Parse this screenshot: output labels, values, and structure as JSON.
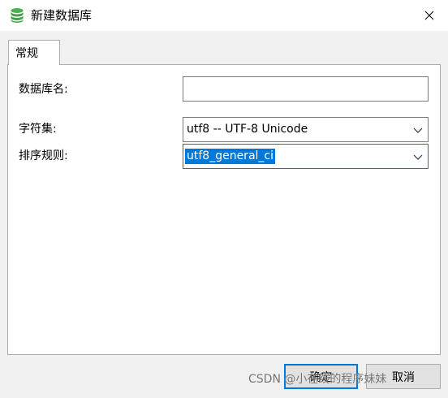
{
  "window": {
    "title": "新建数据库",
    "icon": "database-icon",
    "close_icon": "close-icon"
  },
  "tabs": [
    {
      "label": "常规",
      "active": true
    }
  ],
  "form": {
    "db_name": {
      "label": "数据库名:",
      "value": ""
    },
    "charset": {
      "label": "字符集:",
      "value": "utf8 -- UTF-8 Unicode"
    },
    "collation": {
      "label": "排序规则:",
      "value": "utf8_general_ci"
    }
  },
  "buttons": {
    "ok": "确定",
    "cancel": "取消"
  },
  "watermark": "CSDN @小在线的程序妹妹",
  "colors": {
    "accent": "#0078d7",
    "icon_green": "#4caf50"
  }
}
